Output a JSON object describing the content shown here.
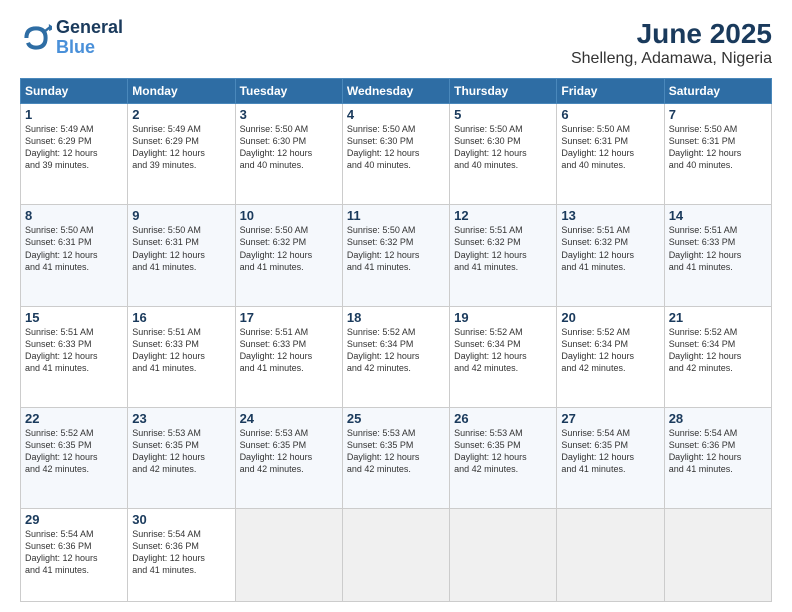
{
  "header": {
    "logo_line1": "General",
    "logo_line2": "Blue",
    "title": "June 2025",
    "subtitle": "Shelleng, Adamawa, Nigeria"
  },
  "weekdays": [
    "Sunday",
    "Monday",
    "Tuesday",
    "Wednesday",
    "Thursday",
    "Friday",
    "Saturday"
  ],
  "weeks": [
    [
      {
        "day": "1",
        "info": "Sunrise: 5:49 AM\nSunset: 6:29 PM\nDaylight: 12 hours\nand 39 minutes."
      },
      {
        "day": "2",
        "info": "Sunrise: 5:49 AM\nSunset: 6:29 PM\nDaylight: 12 hours\nand 39 minutes."
      },
      {
        "day": "3",
        "info": "Sunrise: 5:50 AM\nSunset: 6:30 PM\nDaylight: 12 hours\nand 40 minutes."
      },
      {
        "day": "4",
        "info": "Sunrise: 5:50 AM\nSunset: 6:30 PM\nDaylight: 12 hours\nand 40 minutes."
      },
      {
        "day": "5",
        "info": "Sunrise: 5:50 AM\nSunset: 6:30 PM\nDaylight: 12 hours\nand 40 minutes."
      },
      {
        "day": "6",
        "info": "Sunrise: 5:50 AM\nSunset: 6:31 PM\nDaylight: 12 hours\nand 40 minutes."
      },
      {
        "day": "7",
        "info": "Sunrise: 5:50 AM\nSunset: 6:31 PM\nDaylight: 12 hours\nand 40 minutes."
      }
    ],
    [
      {
        "day": "8",
        "info": "Sunrise: 5:50 AM\nSunset: 6:31 PM\nDaylight: 12 hours\nand 41 minutes."
      },
      {
        "day": "9",
        "info": "Sunrise: 5:50 AM\nSunset: 6:31 PM\nDaylight: 12 hours\nand 41 minutes."
      },
      {
        "day": "10",
        "info": "Sunrise: 5:50 AM\nSunset: 6:32 PM\nDaylight: 12 hours\nand 41 minutes."
      },
      {
        "day": "11",
        "info": "Sunrise: 5:50 AM\nSunset: 6:32 PM\nDaylight: 12 hours\nand 41 minutes."
      },
      {
        "day": "12",
        "info": "Sunrise: 5:51 AM\nSunset: 6:32 PM\nDaylight: 12 hours\nand 41 minutes."
      },
      {
        "day": "13",
        "info": "Sunrise: 5:51 AM\nSunset: 6:32 PM\nDaylight: 12 hours\nand 41 minutes."
      },
      {
        "day": "14",
        "info": "Sunrise: 5:51 AM\nSunset: 6:33 PM\nDaylight: 12 hours\nand 41 minutes."
      }
    ],
    [
      {
        "day": "15",
        "info": "Sunrise: 5:51 AM\nSunset: 6:33 PM\nDaylight: 12 hours\nand 41 minutes."
      },
      {
        "day": "16",
        "info": "Sunrise: 5:51 AM\nSunset: 6:33 PM\nDaylight: 12 hours\nand 41 minutes."
      },
      {
        "day": "17",
        "info": "Sunrise: 5:51 AM\nSunset: 6:33 PM\nDaylight: 12 hours\nand 41 minutes."
      },
      {
        "day": "18",
        "info": "Sunrise: 5:52 AM\nSunset: 6:34 PM\nDaylight: 12 hours\nand 42 minutes."
      },
      {
        "day": "19",
        "info": "Sunrise: 5:52 AM\nSunset: 6:34 PM\nDaylight: 12 hours\nand 42 minutes."
      },
      {
        "day": "20",
        "info": "Sunrise: 5:52 AM\nSunset: 6:34 PM\nDaylight: 12 hours\nand 42 minutes."
      },
      {
        "day": "21",
        "info": "Sunrise: 5:52 AM\nSunset: 6:34 PM\nDaylight: 12 hours\nand 42 minutes."
      }
    ],
    [
      {
        "day": "22",
        "info": "Sunrise: 5:52 AM\nSunset: 6:35 PM\nDaylight: 12 hours\nand 42 minutes."
      },
      {
        "day": "23",
        "info": "Sunrise: 5:53 AM\nSunset: 6:35 PM\nDaylight: 12 hours\nand 42 minutes."
      },
      {
        "day": "24",
        "info": "Sunrise: 5:53 AM\nSunset: 6:35 PM\nDaylight: 12 hours\nand 42 minutes."
      },
      {
        "day": "25",
        "info": "Sunrise: 5:53 AM\nSunset: 6:35 PM\nDaylight: 12 hours\nand 42 minutes."
      },
      {
        "day": "26",
        "info": "Sunrise: 5:53 AM\nSunset: 6:35 PM\nDaylight: 12 hours\nand 42 minutes."
      },
      {
        "day": "27",
        "info": "Sunrise: 5:54 AM\nSunset: 6:35 PM\nDaylight: 12 hours\nand 41 minutes."
      },
      {
        "day": "28",
        "info": "Sunrise: 5:54 AM\nSunset: 6:36 PM\nDaylight: 12 hours\nand 41 minutes."
      }
    ],
    [
      {
        "day": "29",
        "info": "Sunrise: 5:54 AM\nSunset: 6:36 PM\nDaylight: 12 hours\nand 41 minutes."
      },
      {
        "day": "30",
        "info": "Sunrise: 5:54 AM\nSunset: 6:36 PM\nDaylight: 12 hours\nand 41 minutes."
      },
      {
        "day": "",
        "info": ""
      },
      {
        "day": "",
        "info": ""
      },
      {
        "day": "",
        "info": ""
      },
      {
        "day": "",
        "info": ""
      },
      {
        "day": "",
        "info": ""
      }
    ]
  ]
}
